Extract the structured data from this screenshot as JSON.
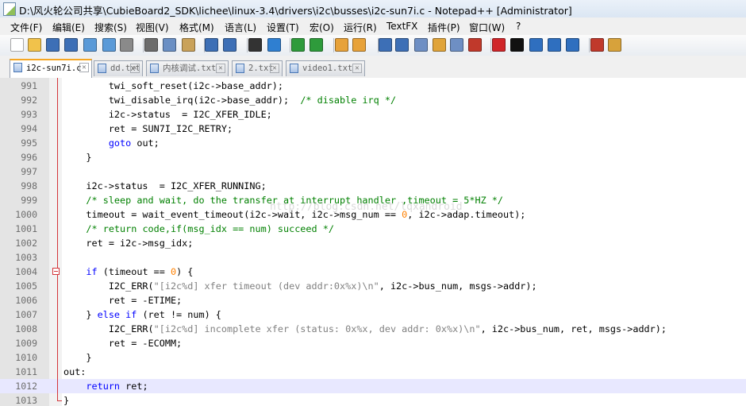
{
  "window": {
    "title": "D:\\风火轮公司共享\\CubieBoard2_SDK\\lichee\\linux-3.4\\drivers\\i2c\\busses\\i2c-sun7i.c - Notepad++ [Administrator]"
  },
  "menu": [
    "文件(F)",
    "编辑(E)",
    "搜索(S)",
    "视图(V)",
    "格式(M)",
    "语言(L)",
    "设置(T)",
    "宏(O)",
    "运行(R)",
    "TextFX",
    "插件(P)",
    "窗口(W)",
    "?"
  ],
  "toolbar_icons": [
    "new-file-icon",
    "open-file-icon",
    "save-icon",
    "save-all-icon",
    "close-icon",
    "close-all-icon",
    "print-icon",
    "cut-icon",
    "copy-icon",
    "paste-icon",
    "undo-icon",
    "redo-icon",
    "find-icon",
    "replace-icon",
    "zoom-in-icon",
    "zoom-out-icon",
    "sync-v-icon",
    "sync-h-icon",
    "word-wrap-icon",
    "show-all-chars-icon",
    "indent-guide-icon",
    "udl-icon",
    "doc-map-icon",
    "function-list-icon",
    "record-macro-icon",
    "stop-macro-icon",
    "play-macro-icon",
    "run-macro-icon",
    "save-macro-icon",
    "spell-check-icon",
    "plugin-icon"
  ],
  "tabs": [
    {
      "label": "i2c-sun7i.c",
      "active": true
    },
    {
      "label": "dd.txt",
      "active": false
    },
    {
      "label": "内核调试.txt",
      "active": false
    },
    {
      "label": "2.txt",
      "active": false
    },
    {
      "label": "video1.txt",
      "active": false
    }
  ],
  "watermark": "http://blog.csdn.net/lqxandroid",
  "editor": {
    "current_line": "1012",
    "lines": [
      {
        "n": "991",
        "t": [
          {
            "k": "",
            "s": "\t\ttwi_soft_reset(i2c->base_addr);"
          }
        ]
      },
      {
        "n": "992",
        "t": [
          {
            "k": "",
            "s": "\t\ttwi_disable_irq(i2c->base_addr);  "
          },
          {
            "k": "cm",
            "s": "/* disable irq */"
          }
        ]
      },
      {
        "n": "993",
        "t": [
          {
            "k": "",
            "s": "\t\ti2c->status  = I2C_XFER_IDLE;"
          }
        ]
      },
      {
        "n": "994",
        "t": [
          {
            "k": "",
            "s": "\t\tret = SUN7I_I2C_RETRY;"
          }
        ]
      },
      {
        "n": "995",
        "t": [
          {
            "k": "",
            "s": "\t\t"
          },
          {
            "k": "kw",
            "s": "goto"
          },
          {
            "k": "",
            "s": " out;"
          }
        ]
      },
      {
        "n": "996",
        "t": [
          {
            "k": "",
            "s": "\t}"
          }
        ]
      },
      {
        "n": "997",
        "t": [
          {
            "k": "",
            "s": ""
          }
        ]
      },
      {
        "n": "998",
        "t": [
          {
            "k": "",
            "s": "\ti2c->status  = I2C_XFER_RUNNING;"
          }
        ]
      },
      {
        "n": "999",
        "t": [
          {
            "k": "",
            "s": "\t"
          },
          {
            "k": "cm",
            "s": "/* sleep and wait, do the transfer at interrupt handler ,timeout = 5*HZ */"
          }
        ]
      },
      {
        "n": "1000",
        "t": [
          {
            "k": "",
            "s": "\ttimeout = wait_event_timeout(i2c->wait, i2c->msg_num == "
          },
          {
            "k": "nm",
            "s": "0"
          },
          {
            "k": "",
            "s": ", i2c->adap.timeout);"
          }
        ]
      },
      {
        "n": "1001",
        "t": [
          {
            "k": "",
            "s": "\t"
          },
          {
            "k": "cm",
            "s": "/* return code,if(msg_idx == num) succeed */"
          }
        ]
      },
      {
        "n": "1002",
        "t": [
          {
            "k": "",
            "s": "\tret = i2c->msg_idx;"
          }
        ]
      },
      {
        "n": "1003",
        "t": [
          {
            "k": "",
            "s": ""
          }
        ]
      },
      {
        "n": "1004",
        "t": [
          {
            "k": "",
            "s": "\t"
          },
          {
            "k": "kw",
            "s": "if"
          },
          {
            "k": "",
            "s": " (timeout == "
          },
          {
            "k": "nm",
            "s": "0"
          },
          {
            "k": "",
            "s": ") {"
          }
        ]
      },
      {
        "n": "1005",
        "t": [
          {
            "k": "",
            "s": "\t\tI2C_ERR("
          },
          {
            "k": "st",
            "s": "\"[i2c%d] xfer timeout (dev addr:0x%x)\\n\""
          },
          {
            "k": "",
            "s": ", i2c->bus_num, msgs->addr);"
          }
        ]
      },
      {
        "n": "1006",
        "t": [
          {
            "k": "",
            "s": "\t\tret = -ETIME;"
          }
        ]
      },
      {
        "n": "1007",
        "t": [
          {
            "k": "",
            "s": "\t} "
          },
          {
            "k": "kw",
            "s": "else if"
          },
          {
            "k": "",
            "s": " (ret != num) {"
          }
        ]
      },
      {
        "n": "1008",
        "t": [
          {
            "k": "",
            "s": "\t\tI2C_ERR("
          },
          {
            "k": "st",
            "s": "\"[i2c%d] incomplete xfer (status: 0x%x, dev addr: 0x%x)\\n\""
          },
          {
            "k": "",
            "s": ", i2c->bus_num, ret, msgs->addr);"
          }
        ]
      },
      {
        "n": "1009",
        "t": [
          {
            "k": "",
            "s": "\t\tret = -ECOMM;"
          }
        ]
      },
      {
        "n": "1010",
        "t": [
          {
            "k": "",
            "s": "\t}"
          }
        ]
      },
      {
        "n": "1011",
        "t": [
          {
            "k": "",
            "s": "out:"
          }
        ]
      },
      {
        "n": "1012",
        "t": [
          {
            "k": "",
            "s": "\t"
          },
          {
            "k": "kw",
            "s": "return"
          },
          {
            "k": "",
            "s": " ret;"
          }
        ]
      },
      {
        "n": "1013",
        "t": [
          {
            "k": "",
            "s": "}"
          }
        ]
      }
    ]
  }
}
